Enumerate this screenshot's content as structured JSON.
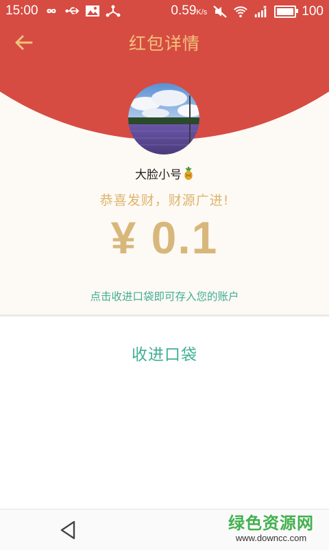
{
  "status_bar": {
    "time": "15:00",
    "data_rate": "0.59",
    "data_rate_unit": "K/s",
    "battery": "100",
    "battery_level_percent": 100,
    "icons": [
      "infinity-icon",
      "usb-icon",
      "image-icon",
      "share-icon",
      "mute-icon",
      "wifi-icon",
      "signal-icon",
      "battery-icon"
    ]
  },
  "header": {
    "title": "红包详情",
    "back_icon": "arrow-left-icon"
  },
  "red_packet": {
    "sender": "大脸小号",
    "sender_emoji": "pineapple-icon",
    "blessing": "恭喜发财，财源广进!",
    "amount": "¥ 0.1",
    "hint": "点击收进口袋即可存入您的账户"
  },
  "action": {
    "collect_label": "收进口袋"
  },
  "nav_bar": {
    "back_icon": "triangle-back-icon"
  },
  "watermark": {
    "title": "绿色资源网",
    "url": "www.downcc.com"
  },
  "colors": {
    "header_red": "#d64c42",
    "title_gold": "#f3c27c",
    "amount_gold": "#d8b77b",
    "accent_green": "#3fae94",
    "panel_bg": "#fdf9f4"
  }
}
